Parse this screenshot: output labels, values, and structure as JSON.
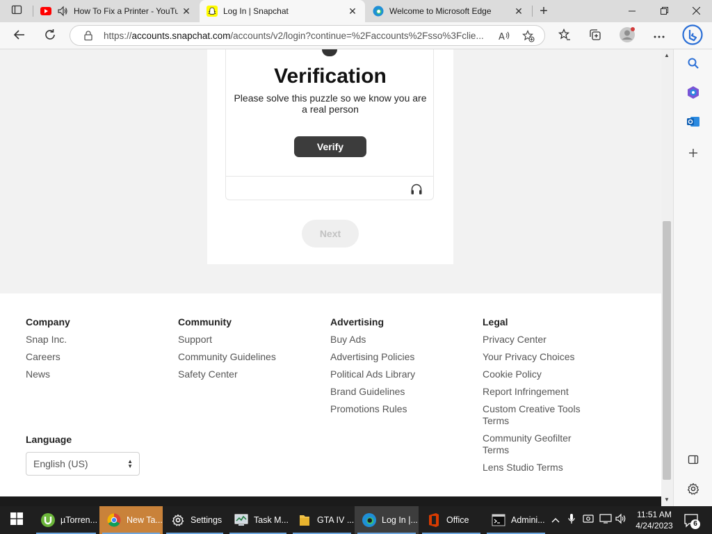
{
  "browser": {
    "tabs": [
      {
        "title": "How To Fix a Printer - YouTube",
        "active": false
      },
      {
        "title": "Log In | Snapchat",
        "active": true
      },
      {
        "title": "Welcome to Microsoft Edge",
        "active": false
      }
    ],
    "address": {
      "prefix": "https://",
      "host": "accounts.snapchat.com",
      "path": "/accounts/v2/login?continue=%2Faccounts%2Fsso%3Fclie..."
    }
  },
  "verification": {
    "title": "Verification",
    "description": "Please solve this puzzle so we know you are a real person",
    "verify_label": "Verify",
    "next_label": "Next"
  },
  "footer": {
    "columns": [
      {
        "heading": "Company",
        "links": [
          "Snap Inc.",
          "Careers",
          "News"
        ]
      },
      {
        "heading": "Community",
        "links": [
          "Support",
          "Community Guidelines",
          "Safety Center"
        ]
      },
      {
        "heading": "Advertising",
        "links": [
          "Buy Ads",
          "Advertising Policies",
          "Political Ads Library",
          "Brand Guidelines",
          "Promotions Rules"
        ]
      },
      {
        "heading": "Legal",
        "links": [
          "Privacy Center",
          "Your Privacy Choices",
          "Cookie Policy",
          "Report Infringement",
          "Custom Creative Tools Terms",
          "Community Geofilter Terms",
          "Lens Studio Terms"
        ]
      }
    ],
    "language_label": "Language",
    "language_value": "English (US)"
  },
  "taskbar": {
    "items": [
      "µTorren...",
      "New Ta...",
      "Settings",
      "Task M...",
      "GTA IV ...",
      "Log In |...",
      "Office",
      "Admini..."
    ],
    "time": "11:51 AM",
    "date": "4/24/2023",
    "notification_count": "6"
  },
  "colors": {
    "accent_highlight": "#c9823a",
    "verify_button": "#3c3c3c",
    "page_background": "#f2f2f2"
  }
}
